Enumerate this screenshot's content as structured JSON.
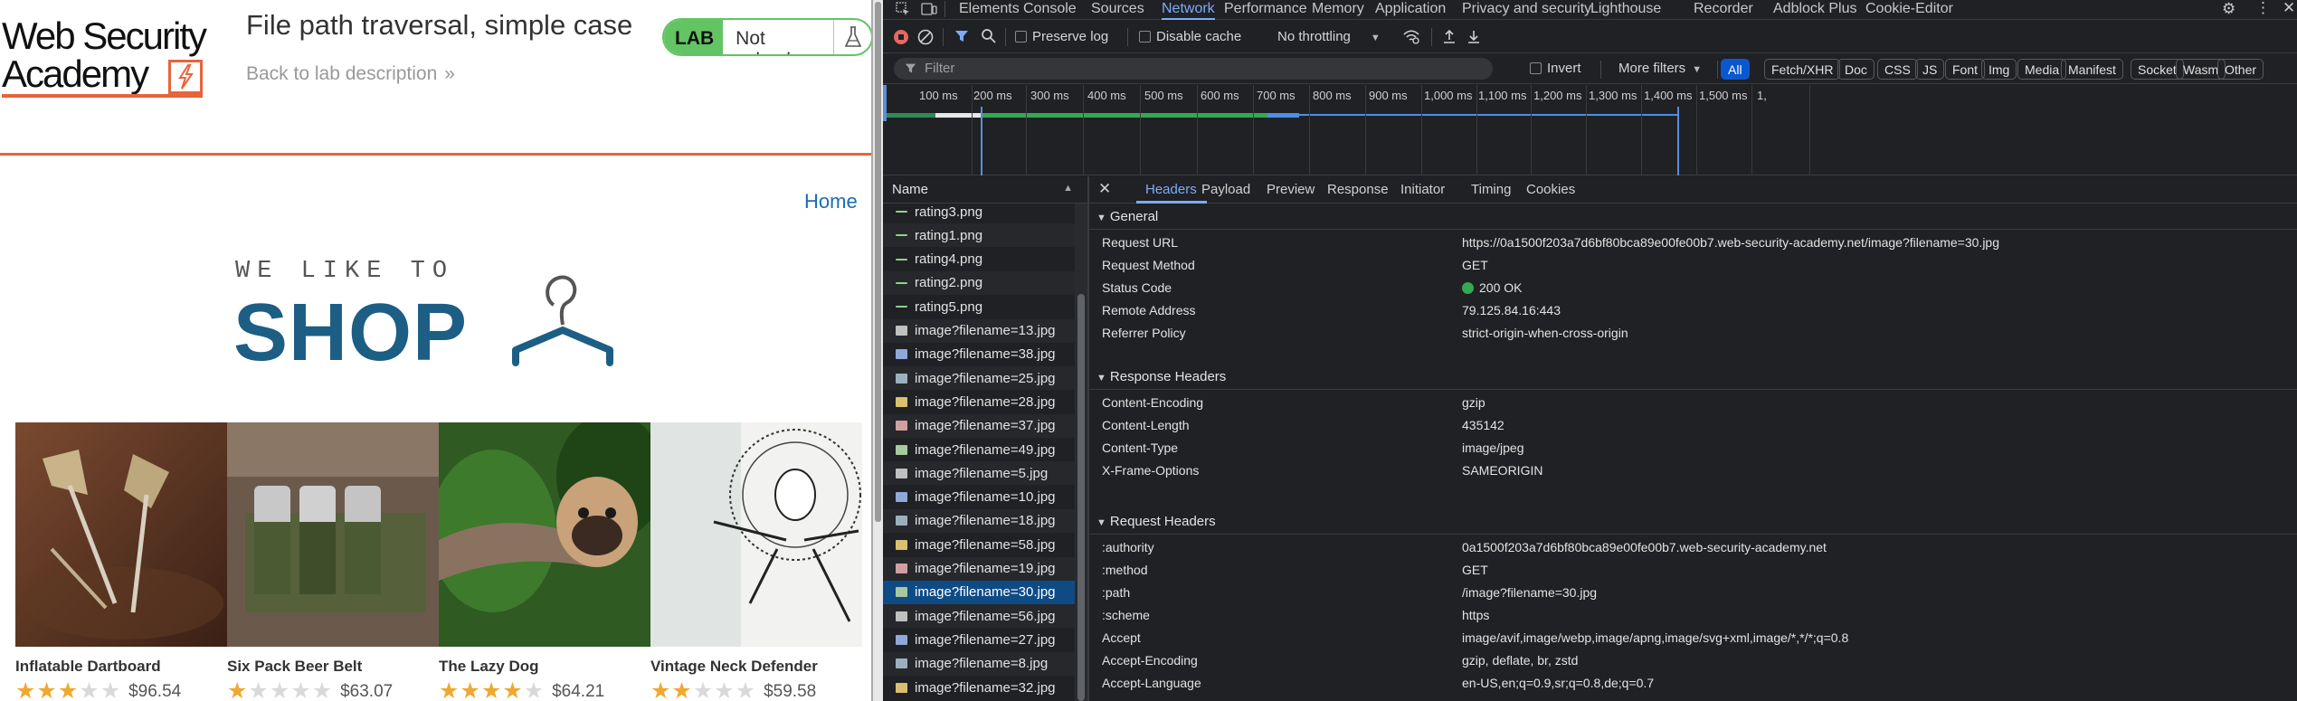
{
  "lab": {
    "logo_line1": "Web Security",
    "logo_line2": "Academy",
    "title": "File path traversal, simple case",
    "back_link": "Back to lab description",
    "back_chevrons": "»",
    "badge_label": "LAB",
    "badge_status": "Not solved",
    "home_link": "Home",
    "shop_tagline": "WE LIKE TO",
    "shop_word": "SHOP",
    "accent_color": "#e8643a",
    "status_color": "#62c462",
    "products": [
      {
        "name": "Inflatable Dartboard",
        "stars": 3,
        "price": "$96.54"
      },
      {
        "name": "Six Pack Beer Belt",
        "stars": 1,
        "price": "$63.07"
      },
      {
        "name": "The Lazy Dog",
        "stars": 4,
        "price": "$64.21"
      },
      {
        "name": "Vintage Neck Defender",
        "stars": 2,
        "price": "$59.58"
      }
    ]
  },
  "devtools": {
    "tabs": [
      "Elements",
      "Console",
      "Sources",
      "Network",
      "Performance",
      "Memory",
      "Application",
      "Privacy and security",
      "Lighthouse",
      "Recorder",
      "Adblock Plus",
      "Cookie-Editor"
    ],
    "active_tab": "Network",
    "toolbar": {
      "preserve_log": "Preserve log",
      "disable_cache": "Disable cache",
      "throttling": "No throttling"
    },
    "filter": {
      "placeholder": "Filter",
      "invert": "Invert",
      "more_filters": "More filters",
      "chips": [
        "All",
        "Fetch/XHR",
        "Doc",
        "CSS",
        "JS",
        "Font",
        "Img",
        "Media",
        "Manifest",
        "Socket",
        "Wasm",
        "Other"
      ]
    },
    "timeline_ticks": [
      "100 ms",
      "200 ms",
      "300 ms",
      "400 ms",
      "500 ms",
      "600 ms",
      "700 ms",
      "800 ms",
      "900 ms",
      "1,000 ms",
      "1,100 ms",
      "1,200 ms",
      "1,300 ms",
      "1,400 ms",
      "1,500 ms",
      "1,"
    ],
    "name_header": "Name",
    "requests": [
      {
        "name": "rating3.png",
        "icon": "dash"
      },
      {
        "name": "rating1.png",
        "icon": "dash"
      },
      {
        "name": "rating4.png",
        "icon": "dash"
      },
      {
        "name": "rating2.png",
        "icon": "dash"
      },
      {
        "name": "rating5.png",
        "icon": "dash"
      },
      {
        "name": "image?filename=13.jpg",
        "icon": "image"
      },
      {
        "name": "image?filename=38.jpg",
        "icon": "image"
      },
      {
        "name": "image?filename=25.jpg",
        "icon": "image"
      },
      {
        "name": "image?filename=28.jpg",
        "icon": "image"
      },
      {
        "name": "image?filename=37.jpg",
        "icon": "image"
      },
      {
        "name": "image?filename=49.jpg",
        "icon": "image"
      },
      {
        "name": "image?filename=5.jpg",
        "icon": "image"
      },
      {
        "name": "image?filename=10.jpg",
        "icon": "image"
      },
      {
        "name": "image?filename=18.jpg",
        "icon": "image"
      },
      {
        "name": "image?filename=58.jpg",
        "icon": "image"
      },
      {
        "name": "image?filename=19.jpg",
        "icon": "image"
      },
      {
        "name": "image?filename=30.jpg",
        "icon": "image",
        "selected": true
      },
      {
        "name": "image?filename=56.jpg",
        "icon": "image"
      },
      {
        "name": "image?filename=27.jpg",
        "icon": "image"
      },
      {
        "name": "image?filename=8.jpg",
        "icon": "image"
      },
      {
        "name": "image?filename=32.jpg",
        "icon": "image"
      }
    ],
    "detail_tabs": [
      "Headers",
      "Payload",
      "Preview",
      "Response",
      "Initiator",
      "Timing",
      "Cookies"
    ],
    "active_detail_tab": "Headers",
    "sections": {
      "general": {
        "title": "General",
        "rows": [
          {
            "key": "Request URL",
            "value": "https://0a1500f203a7d6bf80bca89e00fe00b7.web-security-academy.net/image?filename=30.jpg"
          },
          {
            "key": "Request Method",
            "value": "GET"
          },
          {
            "key": "Status Code",
            "value": "200 OK"
          },
          {
            "key": "Remote Address",
            "value": "79.125.84.16:443"
          },
          {
            "key": "Referrer Policy",
            "value": "strict-origin-when-cross-origin"
          }
        ]
      },
      "response": {
        "title": "Response Headers",
        "rows": [
          {
            "key": "Content-Encoding",
            "value": "gzip"
          },
          {
            "key": "Content-Length",
            "value": "435142"
          },
          {
            "key": "Content-Type",
            "value": "image/jpeg"
          },
          {
            "key": "X-Frame-Options",
            "value": "SAMEORIGIN"
          }
        ]
      },
      "request": {
        "title": "Request Headers",
        "rows": [
          {
            "key": ":authority",
            "value": "0a1500f203a7d6bf80bca89e00fe00b7.web-security-academy.net"
          },
          {
            "key": ":method",
            "value": "GET"
          },
          {
            "key": ":path",
            "value": "/image?filename=30.jpg"
          },
          {
            "key": ":scheme",
            "value": "https"
          },
          {
            "key": "Accept",
            "value": "image/avif,image/webp,image/apng,image/svg+xml,image/*,*/*;q=0.8"
          },
          {
            "key": "Accept-Encoding",
            "value": "gzip, deflate, br, zstd"
          },
          {
            "key": "Accept-Language",
            "value": "en-US,en;q=0.9,sr;q=0.8,de;q=0.7"
          }
        ]
      }
    }
  }
}
